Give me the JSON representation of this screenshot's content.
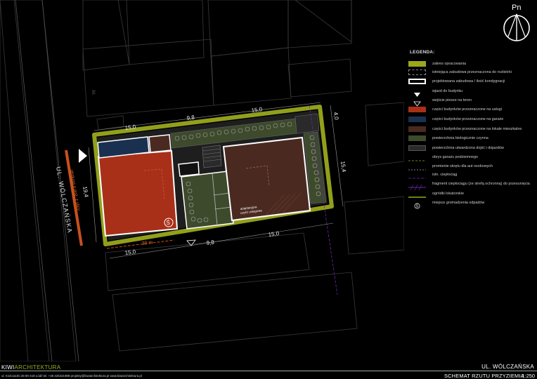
{
  "north": {
    "label": "Pn"
  },
  "legend": {
    "title": "LEGENDA:",
    "items": [
      {
        "label": "zakres opracowania",
        "icon": "olive-fill-swatch"
      },
      {
        "label": "istniejąca zabudowa przeznaczona do rozbiórki",
        "icon": "dashed-outline-swatch"
      },
      {
        "label": "projektowana zabudowa / ilość kondygnacji",
        "icon": "white-outline-swatch"
      },
      {
        "label": "wjazd do budynku",
        "icon": "filled-triangle-icon"
      },
      {
        "label": "wejście piesze na teren",
        "icon": "outline-triangle-icon"
      },
      {
        "label": "części budynków przeznaczone na usługi",
        "icon": "red-swatch"
      },
      {
        "label": "części budynków przeznaczone na garaże",
        "icon": "blue-swatch"
      },
      {
        "label": "części budynków przeznaczone na lokale mieszkalne",
        "icon": "brown-swatch"
      },
      {
        "label": "powierzchnia biologicznie czynna",
        "icon": "green-swatch"
      },
      {
        "label": "powierzchnia utwardzona dojść i dojazdów",
        "icon": "paved-swatch"
      },
      {
        "label": "obrys garażu podziemnego",
        "icon": "dashed-line-swatch"
      },
      {
        "label": "promienie skrętu dla aut osobowych",
        "icon": "dashed-line-swatch"
      },
      {
        "label": "istn. ciepłociąg",
        "icon": "purple-line-swatch"
      },
      {
        "label": "fragment ciepłociągu (ze strefą ochronną) do przesunięcia",
        "icon": "hatched-purple-swatch"
      },
      {
        "label": "ogródki lokatorskie",
        "icon": "olive-line-swatch"
      },
      {
        "label": "miejsce gromadzenia odpadów",
        "icon": "waste-symbol-icon"
      }
    ],
    "colors": {
      "olive": "#9aa81c",
      "red": "#a83018",
      "blue": "#1a3050",
      "brown": "#4a2a20",
      "green": "#3d4a2c",
      "paved": "#2a2a2a",
      "purple": "#6a28a8"
    }
  },
  "plan": {
    "street_name": "UL. WÓLCZAŃSKA",
    "street_service_label": "obsługa p.poż. z ulicy",
    "parcel_number": "96",
    "dim_top": [
      "15,0",
      "9,8",
      "15,0"
    ],
    "dim_bottom": [
      "15,0",
      "9,8",
      "15,0"
    ],
    "dim_left": "19,4",
    "dim_right_top": "4,0",
    "dim_right": "15,4",
    "fire_distance": "30 m",
    "waste_symbol": "Ś",
    "annotation_line1": "adaptacyjna",
    "annotation_line2": "część usługowa"
  },
  "footer": {
    "brand_part1": "KIWI",
    "brand_part2": "ARCHITEKTURA",
    "contact": "ul. Kościuszki 28  90-418 Łódź       tel. +48 426321989      projekty@kiwiarchitektura.pl       www.kiwiarchitektura.pl",
    "street": "UL. WÓLCZAŃSKA",
    "sheet_title": "SCHEMAT RZUTU PRZYZIEMIA",
    "scale": "1:250"
  }
}
